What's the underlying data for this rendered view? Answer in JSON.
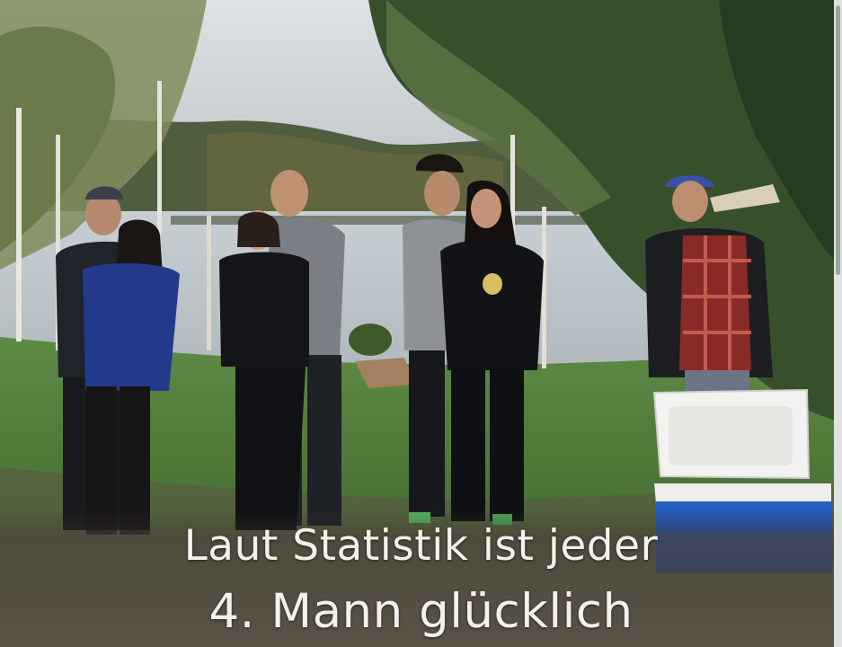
{
  "caption": {
    "line1": "Laut Statistik ist jeder",
    "line2": "4. Mann glücklich"
  },
  "colors": {
    "sky": "#c9cdd0",
    "lake": "#bfc7cc",
    "grass": "#4f7a3a",
    "cooler_blue": "#1f4fa8",
    "cooler_lid": "#f2f2f0",
    "caption_text": "#f4f1ec"
  }
}
